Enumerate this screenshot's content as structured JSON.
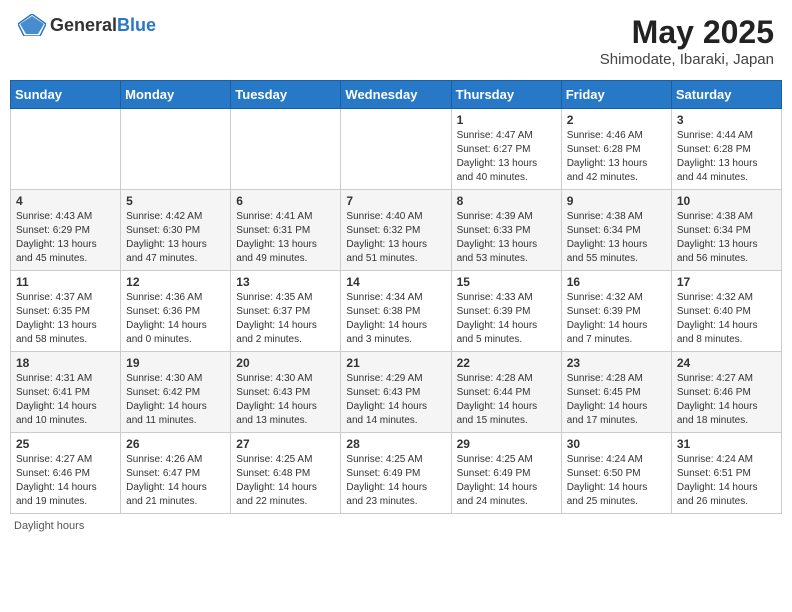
{
  "header": {
    "logo_general": "General",
    "logo_blue": "Blue",
    "title": "May 2025",
    "subtitle": "Shimodate, Ibaraki, Japan"
  },
  "days_of_week": [
    "Sunday",
    "Monday",
    "Tuesday",
    "Wednesday",
    "Thursday",
    "Friday",
    "Saturday"
  ],
  "weeks": [
    [
      {
        "day": "",
        "info": ""
      },
      {
        "day": "",
        "info": ""
      },
      {
        "day": "",
        "info": ""
      },
      {
        "day": "",
        "info": ""
      },
      {
        "day": "1",
        "info": "Sunrise: 4:47 AM\nSunset: 6:27 PM\nDaylight: 13 hours\nand 40 minutes."
      },
      {
        "day": "2",
        "info": "Sunrise: 4:46 AM\nSunset: 6:28 PM\nDaylight: 13 hours\nand 42 minutes."
      },
      {
        "day": "3",
        "info": "Sunrise: 4:44 AM\nSunset: 6:28 PM\nDaylight: 13 hours\nand 44 minutes."
      }
    ],
    [
      {
        "day": "4",
        "info": "Sunrise: 4:43 AM\nSunset: 6:29 PM\nDaylight: 13 hours\nand 45 minutes."
      },
      {
        "day": "5",
        "info": "Sunrise: 4:42 AM\nSunset: 6:30 PM\nDaylight: 13 hours\nand 47 minutes."
      },
      {
        "day": "6",
        "info": "Sunrise: 4:41 AM\nSunset: 6:31 PM\nDaylight: 13 hours\nand 49 minutes."
      },
      {
        "day": "7",
        "info": "Sunrise: 4:40 AM\nSunset: 6:32 PM\nDaylight: 13 hours\nand 51 minutes."
      },
      {
        "day": "8",
        "info": "Sunrise: 4:39 AM\nSunset: 6:33 PM\nDaylight: 13 hours\nand 53 minutes."
      },
      {
        "day": "9",
        "info": "Sunrise: 4:38 AM\nSunset: 6:34 PM\nDaylight: 13 hours\nand 55 minutes."
      },
      {
        "day": "10",
        "info": "Sunrise: 4:38 AM\nSunset: 6:34 PM\nDaylight: 13 hours\nand 56 minutes."
      }
    ],
    [
      {
        "day": "11",
        "info": "Sunrise: 4:37 AM\nSunset: 6:35 PM\nDaylight: 13 hours\nand 58 minutes."
      },
      {
        "day": "12",
        "info": "Sunrise: 4:36 AM\nSunset: 6:36 PM\nDaylight: 14 hours\nand 0 minutes."
      },
      {
        "day": "13",
        "info": "Sunrise: 4:35 AM\nSunset: 6:37 PM\nDaylight: 14 hours\nand 2 minutes."
      },
      {
        "day": "14",
        "info": "Sunrise: 4:34 AM\nSunset: 6:38 PM\nDaylight: 14 hours\nand 3 minutes."
      },
      {
        "day": "15",
        "info": "Sunrise: 4:33 AM\nSunset: 6:39 PM\nDaylight: 14 hours\nand 5 minutes."
      },
      {
        "day": "16",
        "info": "Sunrise: 4:32 AM\nSunset: 6:39 PM\nDaylight: 14 hours\nand 7 minutes."
      },
      {
        "day": "17",
        "info": "Sunrise: 4:32 AM\nSunset: 6:40 PM\nDaylight: 14 hours\nand 8 minutes."
      }
    ],
    [
      {
        "day": "18",
        "info": "Sunrise: 4:31 AM\nSunset: 6:41 PM\nDaylight: 14 hours\nand 10 minutes."
      },
      {
        "day": "19",
        "info": "Sunrise: 4:30 AM\nSunset: 6:42 PM\nDaylight: 14 hours\nand 11 minutes."
      },
      {
        "day": "20",
        "info": "Sunrise: 4:30 AM\nSunset: 6:43 PM\nDaylight: 14 hours\nand 13 minutes."
      },
      {
        "day": "21",
        "info": "Sunrise: 4:29 AM\nSunset: 6:43 PM\nDaylight: 14 hours\nand 14 minutes."
      },
      {
        "day": "22",
        "info": "Sunrise: 4:28 AM\nSunset: 6:44 PM\nDaylight: 14 hours\nand 15 minutes."
      },
      {
        "day": "23",
        "info": "Sunrise: 4:28 AM\nSunset: 6:45 PM\nDaylight: 14 hours\nand 17 minutes."
      },
      {
        "day": "24",
        "info": "Sunrise: 4:27 AM\nSunset: 6:46 PM\nDaylight: 14 hours\nand 18 minutes."
      }
    ],
    [
      {
        "day": "25",
        "info": "Sunrise: 4:27 AM\nSunset: 6:46 PM\nDaylight: 14 hours\nand 19 minutes."
      },
      {
        "day": "26",
        "info": "Sunrise: 4:26 AM\nSunset: 6:47 PM\nDaylight: 14 hours\nand 21 minutes."
      },
      {
        "day": "27",
        "info": "Sunrise: 4:25 AM\nSunset: 6:48 PM\nDaylight: 14 hours\nand 22 minutes."
      },
      {
        "day": "28",
        "info": "Sunrise: 4:25 AM\nSunset: 6:49 PM\nDaylight: 14 hours\nand 23 minutes."
      },
      {
        "day": "29",
        "info": "Sunrise: 4:25 AM\nSunset: 6:49 PM\nDaylight: 14 hours\nand 24 minutes."
      },
      {
        "day": "30",
        "info": "Sunrise: 4:24 AM\nSunset: 6:50 PM\nDaylight: 14 hours\nand 25 minutes."
      },
      {
        "day": "31",
        "info": "Sunrise: 4:24 AM\nSunset: 6:51 PM\nDaylight: 14 hours\nand 26 minutes."
      }
    ]
  ],
  "footer": {
    "daylight_label": "Daylight hours"
  }
}
